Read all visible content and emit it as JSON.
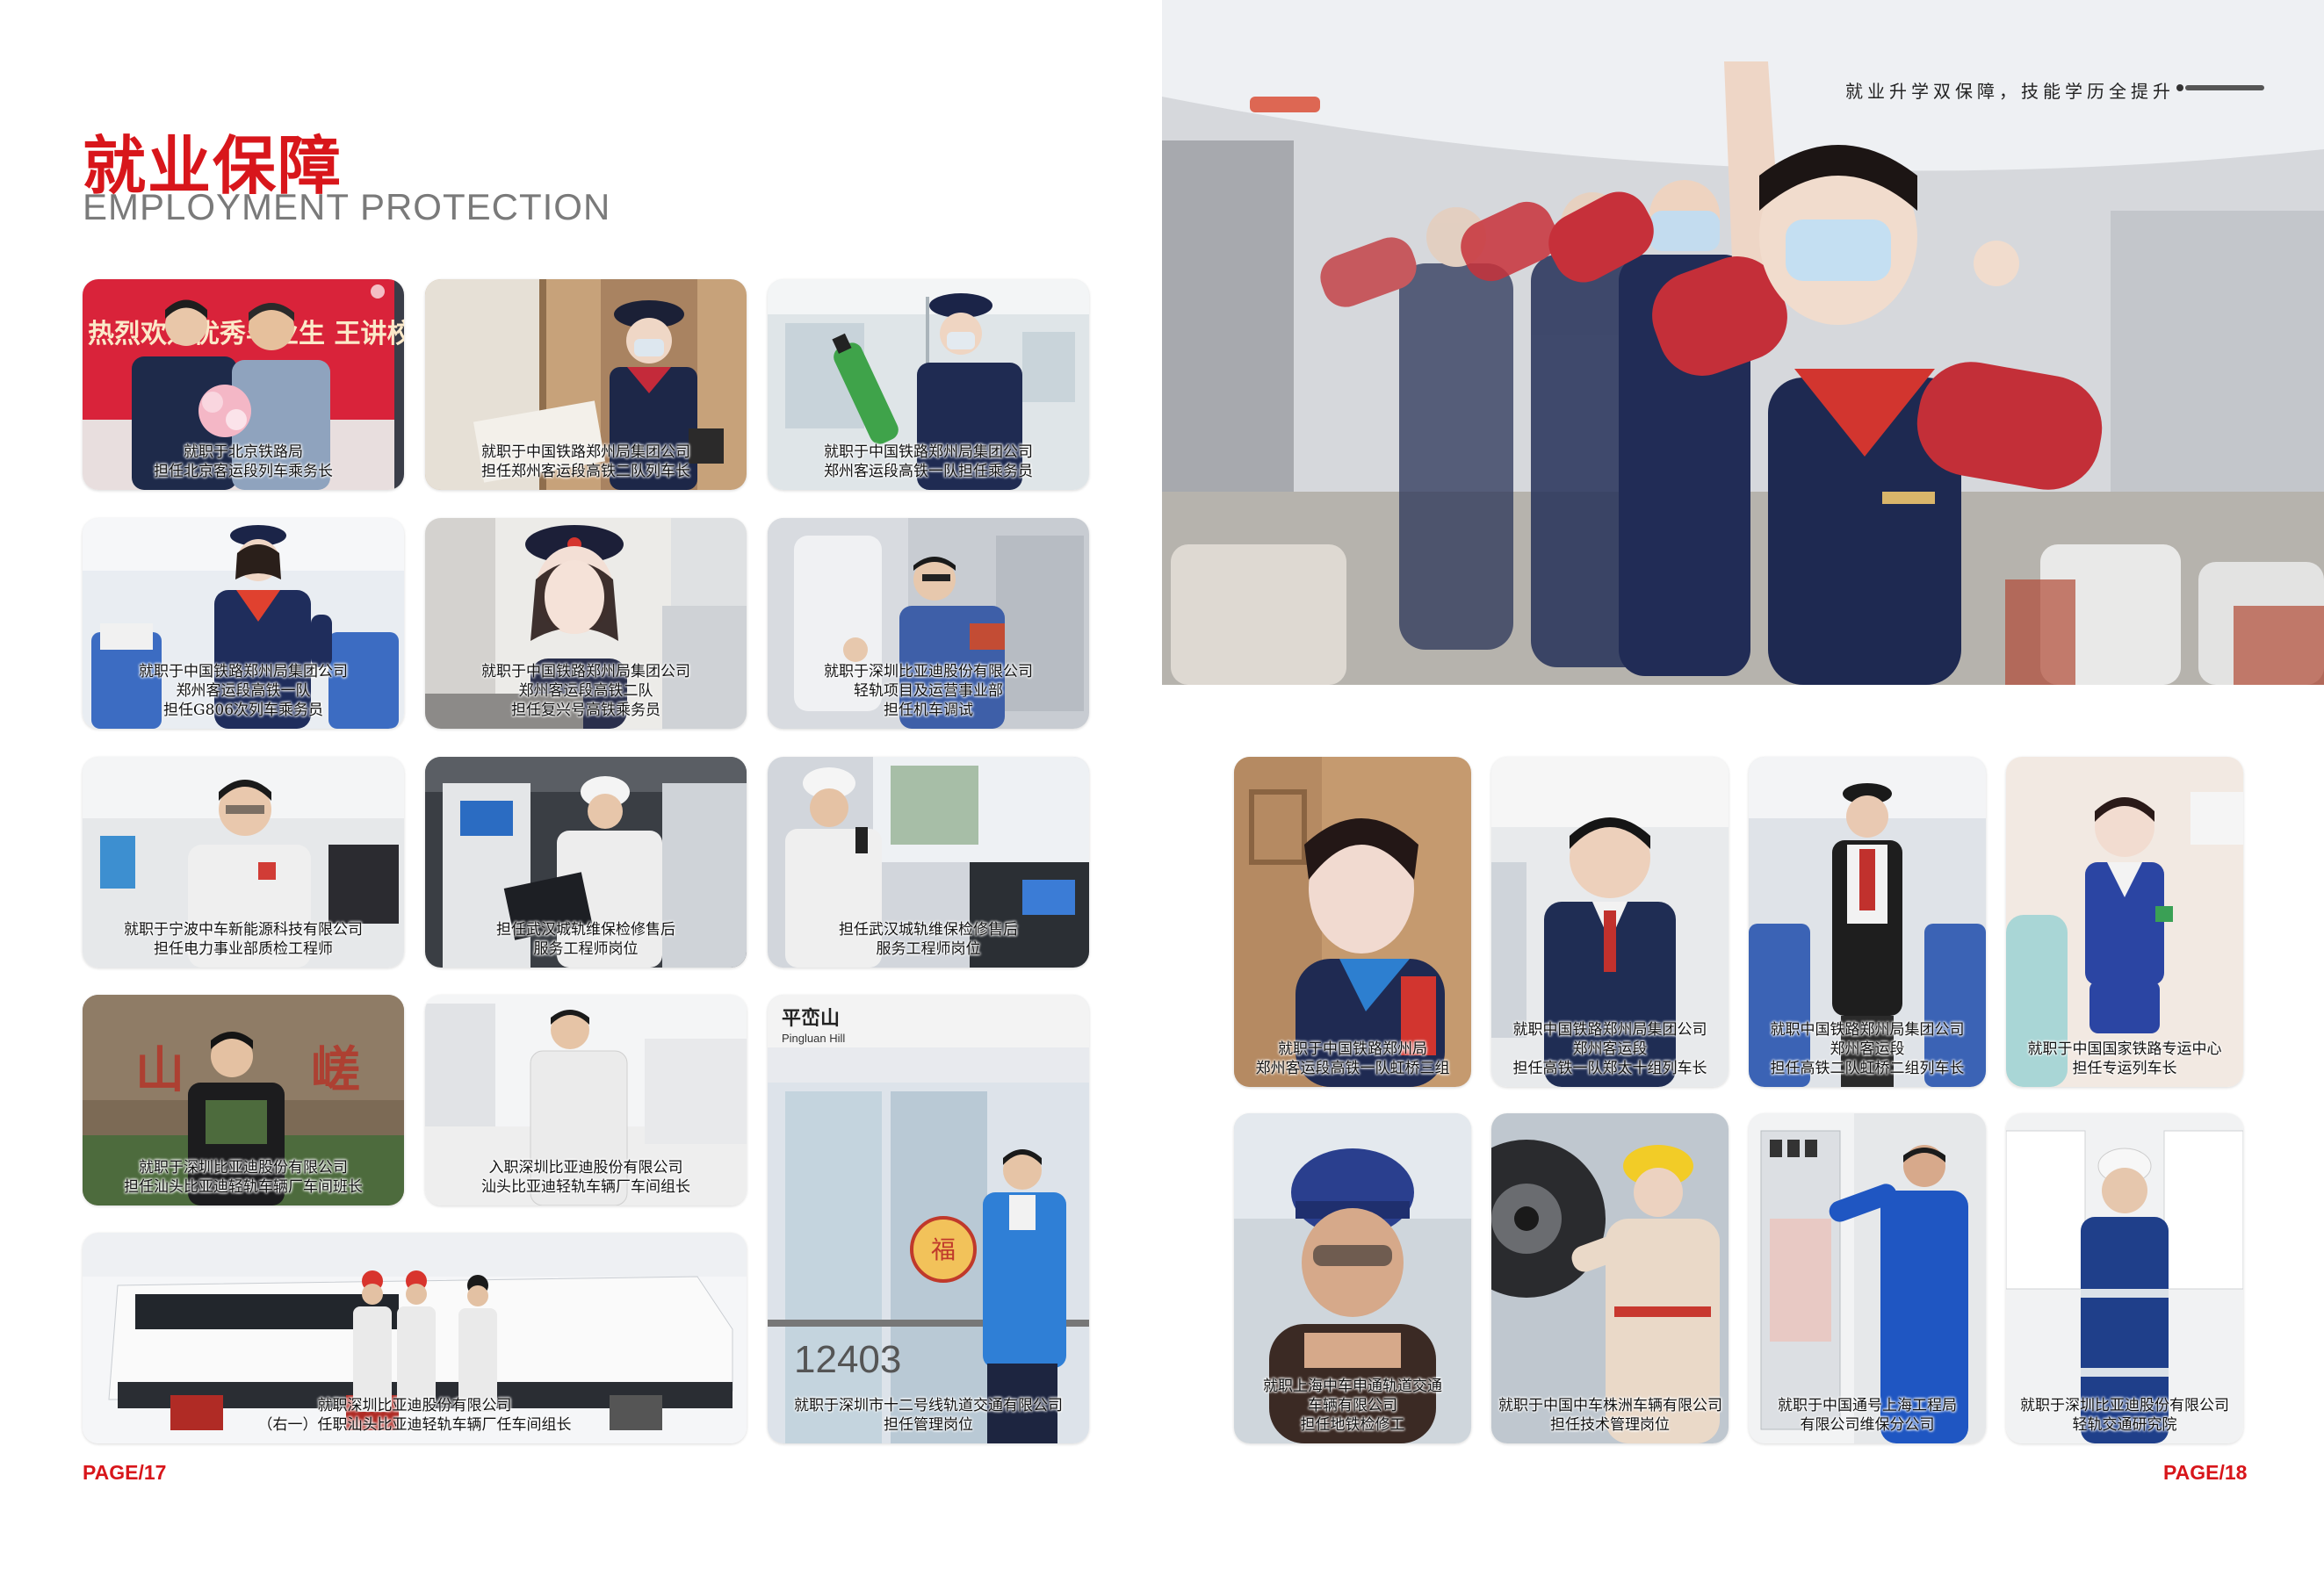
{
  "left_page": {
    "title_cn": "就业保障",
    "title_en": "EMPLOYMENT PROTECTION",
    "page_label": "PAGE/17",
    "photos": [
      {
        "caption": [
          "就职于北京铁路局",
          "担任北京客运段列车乘务长"
        ],
        "sign_text": "热烈欢迎优秀毕业生 王讲校"
      },
      {
        "caption": [
          "就职于中国铁路郑州局集团公司",
          "担任郑州客运段高铁二队列车长"
        ]
      },
      {
        "caption": [
          "就职于中国铁路郑州局集团公司",
          "郑州客运段高铁一队担任乘务员"
        ]
      },
      {
        "caption": [
          "就职于中国铁路郑州局集团公司",
          "郑州客运段高铁一队",
          "担任G806次列车乘务员"
        ]
      },
      {
        "caption": [
          "就职于中国铁路郑州局集团公司",
          "郑州客运段高铁二队",
          "担任复兴号高铁乘务员"
        ]
      },
      {
        "caption": [
          "就职于深圳比亚迪股份有限公司",
          "轻轨项目及运营事业部",
          "担任机车调试"
        ]
      },
      {
        "caption": [
          "就职于宁波中车新能源科技有限公司",
          "担任电力事业部质检工程师"
        ]
      },
      {
        "caption": [
          "担任武汉城轨维保检修售后",
          "服务工程师岗位"
        ]
      },
      {
        "caption": [
          "担任武汉城轨维保检修售后",
          "服务工程师岗位"
        ]
      },
      {
        "caption": [
          "就职于深圳比亚迪股份有限公司",
          "担任汕头比亚迪轻轨车辆厂车间班长"
        ]
      },
      {
        "caption": [
          "入职深圳比亚迪股份有限公司",
          "汕头比亚迪轻轨车辆厂车间组长"
        ]
      },
      {
        "caption": [
          "就职于深圳市十二号线轨道交通有限公司",
          "担任管理岗位"
        ],
        "station_cn": "平峦山",
        "station_en": "Pingluan Hill",
        "train_no": "12403"
      },
      {
        "caption": [
          "就职深圳比亚迪股份有限公司",
          "（右一）任职汕头比亚迪轻轨车辆厂任车间组长"
        ]
      }
    ]
  },
  "right_page": {
    "slogan": "就业升学双保障，技能学历全提升",
    "page_label": "PAGE/18",
    "photos": [
      {
        "caption": [
          "就职于中国铁路郑州局",
          "郑州客运段高铁一队虹桥三组"
        ]
      },
      {
        "caption": [
          "就职中国铁路郑州局集团公司",
          "郑州客运段",
          "担任高铁一队郑太十组列车长"
        ]
      },
      {
        "caption": [
          "就职中国铁路郑州局集团公司",
          "郑州客运段",
          "担任高铁二队虹桥二组列车长"
        ]
      },
      {
        "caption": [
          "就职于中国国家铁路专运中心",
          "担任专运列车长"
        ]
      },
      {
        "caption": [
          "就职上海中车申通轨道交通",
          "车辆有限公司",
          "担任地铁检修工"
        ]
      },
      {
        "caption": [
          "就职于中国中车株洲车辆有限公司",
          "担任技术管理岗位"
        ]
      },
      {
        "caption": [
          "就职于中国通号上海工程局",
          "有限公司维保分公司"
        ]
      },
      {
        "caption": [
          "就职于深圳比亚迪股份有限公司",
          "轻轨交通研究院"
        ]
      }
    ]
  },
  "colors": {
    "accent_red": "#d8161b",
    "title_gray": "#7a7a7a"
  }
}
